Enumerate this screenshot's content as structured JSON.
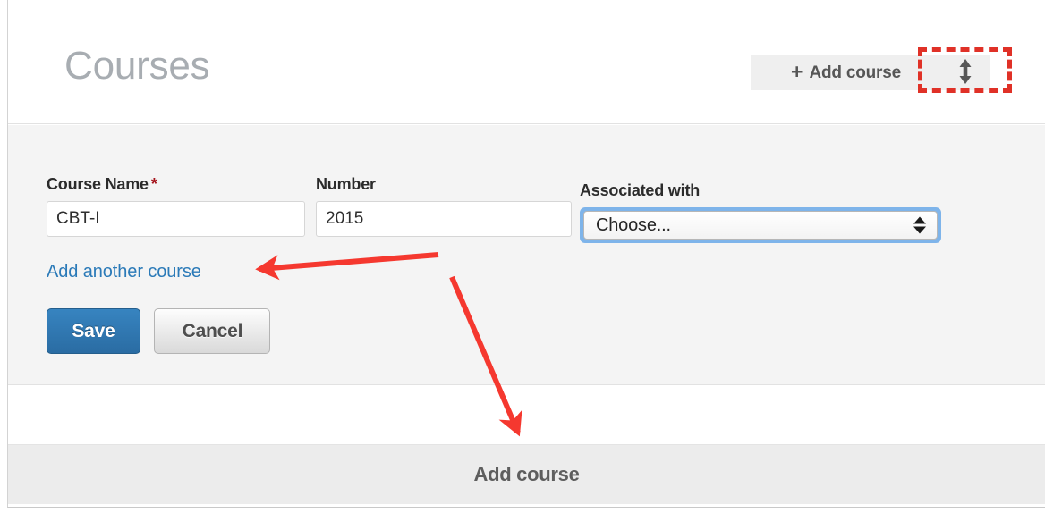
{
  "header": {
    "title": "Courses",
    "add_course_button": {
      "label": "Add course",
      "plus_glyph": "+",
      "icon": "plus-icon"
    },
    "sort_button": {
      "icon": "sort-vertical-arrows-icon",
      "label": ""
    }
  },
  "form": {
    "fields": [
      {
        "label": "Course Name",
        "required_marker": "*",
        "value": "CBT-I",
        "placeholder": ""
      },
      {
        "label": "Number",
        "required_marker": "",
        "value": "2015",
        "placeholder": ""
      }
    ],
    "associated_with": {
      "label": "Associated with",
      "selected": "Choose...",
      "options": [
        "Choose..."
      ],
      "arrows_icon": "select-updown-arrows-icon",
      "focus_ring_color": "#7eb4ea"
    },
    "add_another_link": "Add another course",
    "save_button": "Save",
    "cancel_button": "Cancel"
  },
  "footer": {
    "add_course_label": "Add course"
  },
  "annotations": {
    "highlight_color": "#e03127",
    "box_target": "sort-button",
    "arrow_1_target": "add-another-course-link",
    "arrow_2_target": "footer-add-course"
  },
  "colors": {
    "title_gray": "#a8adb2",
    "link_blue": "#2b7ab8",
    "save_blue": "#2a6ca3",
    "required_red": "#a4121a",
    "form_bg": "#f4f4f4",
    "footer_bg": "#ececec",
    "annotation_red": "#e03127"
  }
}
